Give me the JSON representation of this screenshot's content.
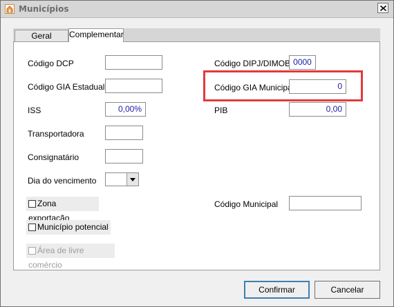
{
  "window": {
    "title": "Municípios"
  },
  "tabs": [
    {
      "label": "Geral"
    },
    {
      "label": "Complementar"
    }
  ],
  "form": {
    "codigo_dcp": {
      "label": "Código DCP",
      "value": ""
    },
    "codigo_gia_estadual": {
      "label": "Código GIA Estadual",
      "value": ""
    },
    "iss": {
      "label": "ISS",
      "value": "0,00%"
    },
    "transportadora": {
      "label": "Transportadora",
      "value": ""
    },
    "consignatario": {
      "label": "Consignatário",
      "value": ""
    },
    "dia_vencimento": {
      "label": "Dia do vencimento",
      "value": ""
    },
    "zona_exportacao": {
      "label": "Zona exportação",
      "checked": false
    },
    "municipio_potencial": {
      "label": "Município potencial",
      "checked": false
    },
    "area_livre_comercio": {
      "label": "Área de livre comércio",
      "checked": false,
      "disabled": true
    },
    "codigo_dipj_dimob": {
      "label": "Código DIPJ/DIMOB",
      "value": "0000"
    },
    "codigo_gia_municipal": {
      "label": "Código GIA Municipal",
      "value": "0"
    },
    "pib": {
      "label": "PIB",
      "value": "0,00"
    },
    "codigo_municipal": {
      "label": "Código Municipal",
      "value": ""
    }
  },
  "buttons": {
    "confirm": "Confirmar",
    "cancel": "Cancelar"
  },
  "colors": {
    "highlight": "#e23a3a",
    "field_text": "#1a1aa6"
  }
}
